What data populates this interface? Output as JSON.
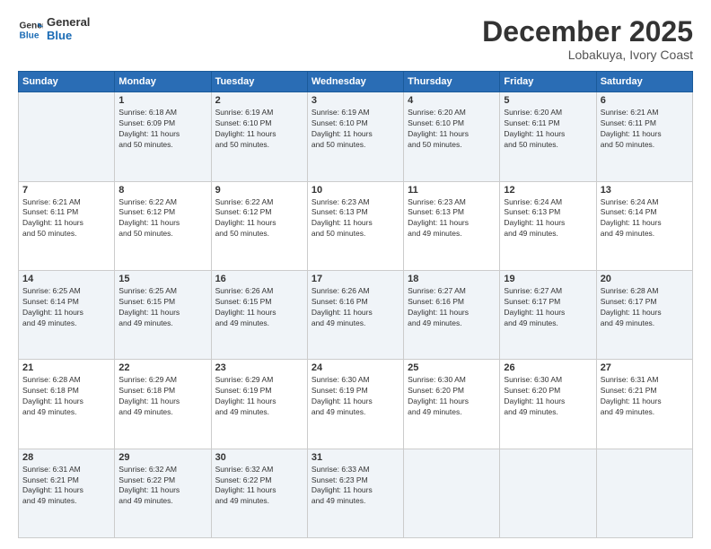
{
  "header": {
    "logo_line1": "General",
    "logo_line2": "Blue",
    "month": "December 2025",
    "location": "Lobakuya, Ivory Coast"
  },
  "days_of_week": [
    "Sunday",
    "Monday",
    "Tuesday",
    "Wednesday",
    "Thursday",
    "Friday",
    "Saturday"
  ],
  "weeks": [
    [
      {
        "day": "",
        "info": ""
      },
      {
        "day": "1",
        "info": "Sunrise: 6:18 AM\nSunset: 6:09 PM\nDaylight: 11 hours\nand 50 minutes."
      },
      {
        "day": "2",
        "info": "Sunrise: 6:19 AM\nSunset: 6:10 PM\nDaylight: 11 hours\nand 50 minutes."
      },
      {
        "day": "3",
        "info": "Sunrise: 6:19 AM\nSunset: 6:10 PM\nDaylight: 11 hours\nand 50 minutes."
      },
      {
        "day": "4",
        "info": "Sunrise: 6:20 AM\nSunset: 6:10 PM\nDaylight: 11 hours\nand 50 minutes."
      },
      {
        "day": "5",
        "info": "Sunrise: 6:20 AM\nSunset: 6:11 PM\nDaylight: 11 hours\nand 50 minutes."
      },
      {
        "day": "6",
        "info": "Sunrise: 6:21 AM\nSunset: 6:11 PM\nDaylight: 11 hours\nand 50 minutes."
      }
    ],
    [
      {
        "day": "7",
        "info": "Sunrise: 6:21 AM\nSunset: 6:11 PM\nDaylight: 11 hours\nand 50 minutes."
      },
      {
        "day": "8",
        "info": "Sunrise: 6:22 AM\nSunset: 6:12 PM\nDaylight: 11 hours\nand 50 minutes."
      },
      {
        "day": "9",
        "info": "Sunrise: 6:22 AM\nSunset: 6:12 PM\nDaylight: 11 hours\nand 50 minutes."
      },
      {
        "day": "10",
        "info": "Sunrise: 6:23 AM\nSunset: 6:13 PM\nDaylight: 11 hours\nand 50 minutes."
      },
      {
        "day": "11",
        "info": "Sunrise: 6:23 AM\nSunset: 6:13 PM\nDaylight: 11 hours\nand 49 minutes."
      },
      {
        "day": "12",
        "info": "Sunrise: 6:24 AM\nSunset: 6:13 PM\nDaylight: 11 hours\nand 49 minutes."
      },
      {
        "day": "13",
        "info": "Sunrise: 6:24 AM\nSunset: 6:14 PM\nDaylight: 11 hours\nand 49 minutes."
      }
    ],
    [
      {
        "day": "14",
        "info": "Sunrise: 6:25 AM\nSunset: 6:14 PM\nDaylight: 11 hours\nand 49 minutes."
      },
      {
        "day": "15",
        "info": "Sunrise: 6:25 AM\nSunset: 6:15 PM\nDaylight: 11 hours\nand 49 minutes."
      },
      {
        "day": "16",
        "info": "Sunrise: 6:26 AM\nSunset: 6:15 PM\nDaylight: 11 hours\nand 49 minutes."
      },
      {
        "day": "17",
        "info": "Sunrise: 6:26 AM\nSunset: 6:16 PM\nDaylight: 11 hours\nand 49 minutes."
      },
      {
        "day": "18",
        "info": "Sunrise: 6:27 AM\nSunset: 6:16 PM\nDaylight: 11 hours\nand 49 minutes."
      },
      {
        "day": "19",
        "info": "Sunrise: 6:27 AM\nSunset: 6:17 PM\nDaylight: 11 hours\nand 49 minutes."
      },
      {
        "day": "20",
        "info": "Sunrise: 6:28 AM\nSunset: 6:17 PM\nDaylight: 11 hours\nand 49 minutes."
      }
    ],
    [
      {
        "day": "21",
        "info": "Sunrise: 6:28 AM\nSunset: 6:18 PM\nDaylight: 11 hours\nand 49 minutes."
      },
      {
        "day": "22",
        "info": "Sunrise: 6:29 AM\nSunset: 6:18 PM\nDaylight: 11 hours\nand 49 minutes."
      },
      {
        "day": "23",
        "info": "Sunrise: 6:29 AM\nSunset: 6:19 PM\nDaylight: 11 hours\nand 49 minutes."
      },
      {
        "day": "24",
        "info": "Sunrise: 6:30 AM\nSunset: 6:19 PM\nDaylight: 11 hours\nand 49 minutes."
      },
      {
        "day": "25",
        "info": "Sunrise: 6:30 AM\nSunset: 6:20 PM\nDaylight: 11 hours\nand 49 minutes."
      },
      {
        "day": "26",
        "info": "Sunrise: 6:30 AM\nSunset: 6:20 PM\nDaylight: 11 hours\nand 49 minutes."
      },
      {
        "day": "27",
        "info": "Sunrise: 6:31 AM\nSunset: 6:21 PM\nDaylight: 11 hours\nand 49 minutes."
      }
    ],
    [
      {
        "day": "28",
        "info": "Sunrise: 6:31 AM\nSunset: 6:21 PM\nDaylight: 11 hours\nand 49 minutes."
      },
      {
        "day": "29",
        "info": "Sunrise: 6:32 AM\nSunset: 6:22 PM\nDaylight: 11 hours\nand 49 minutes."
      },
      {
        "day": "30",
        "info": "Sunrise: 6:32 AM\nSunset: 6:22 PM\nDaylight: 11 hours\nand 49 minutes."
      },
      {
        "day": "31",
        "info": "Sunrise: 6:33 AM\nSunset: 6:23 PM\nDaylight: 11 hours\nand 49 minutes."
      },
      {
        "day": "",
        "info": ""
      },
      {
        "day": "",
        "info": ""
      },
      {
        "day": "",
        "info": ""
      }
    ]
  ]
}
